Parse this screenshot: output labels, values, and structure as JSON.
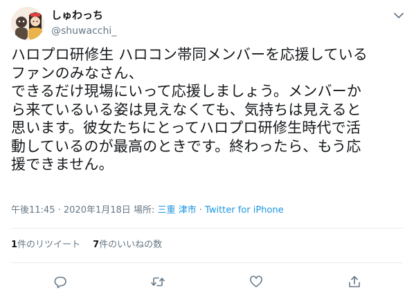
{
  "user": {
    "display_name": "しゅわっち",
    "handle": "@shuwacchi_",
    "avatar_icon": "avatar-illustration-icon"
  },
  "tweet": {
    "lines": [
      "ハロプロ研修生 ハロコン帯同メンバーを応援している",
      "ファンのみなさん、",
      "できるだけ現場にいって応援しましょう。メンバーか",
      "ら来ているいる姿は見えなくても、気持ちは見えると",
      "思います。彼女たちにとってハロプロ研修生時代で活",
      "動しているのが最高のときです。終わったら、もう応",
      "援できません。"
    ]
  },
  "meta": {
    "time": "午後11:45",
    "sep": "·",
    "date": "2020年1月18日",
    "location_label": "場所:",
    "location": "三重 津市",
    "source": "Twitter for iPhone"
  },
  "stats": {
    "retweets_count": "1",
    "retweets_label": "件のリツイート",
    "likes_count": "7",
    "likes_label": "件のいいねの数"
  },
  "icons": {
    "caret": "chevron-down-icon",
    "reply": "reply-icon",
    "retweet": "retweet-icon",
    "like": "heart-icon",
    "share": "share-icon"
  },
  "colors": {
    "link": "#1b95e0",
    "secondary_text": "#657786",
    "divider": "#e6ecf0"
  }
}
